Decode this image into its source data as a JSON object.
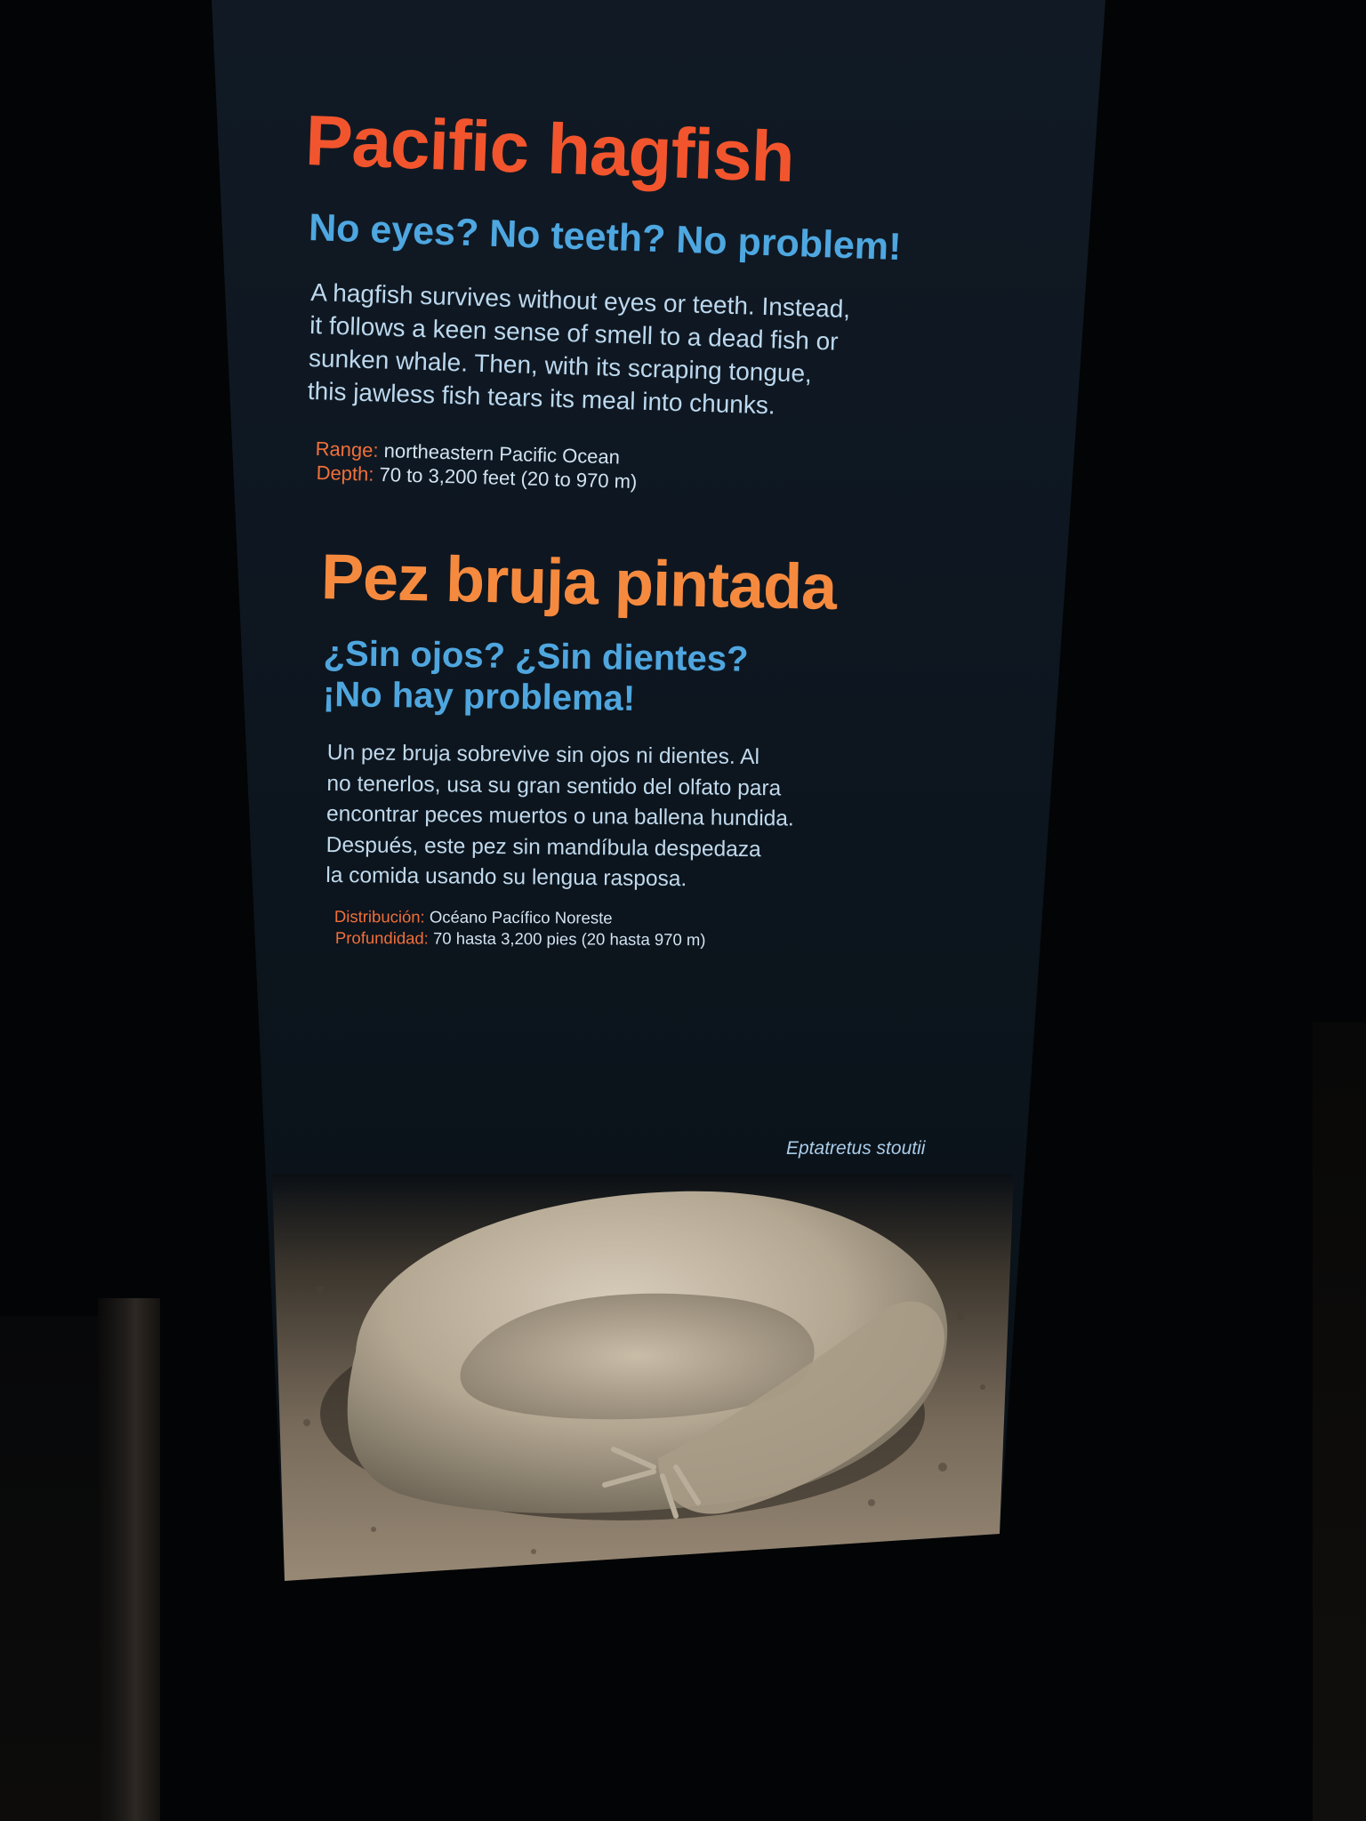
{
  "english": {
    "title": "Pacific hagfish",
    "subtitle": "No eyes? No teeth? No problem!",
    "body_lines": [
      "A hagfish survives without eyes or teeth. Instead,",
      "it follows a keen sense of smell to a dead fish or",
      "sunken whale. Then, with its scraping tongue,",
      "this jawless fish tears its meal into chunks."
    ],
    "range_label": "Range:",
    "range_value": "northeastern Pacific Ocean",
    "depth_label": "Depth:",
    "depth_value": "70 to 3,200 feet (20 to 970 m)"
  },
  "spanish": {
    "title": "Pez bruja pintada",
    "subtitle_lines": [
      "¿Sin ojos? ¿Sin dientes?",
      "¡No hay problema!"
    ],
    "body_lines": [
      "Un pez bruja sobrevive sin ojos ni dientes. Al",
      "no tenerlos, usa su gran sentido del olfato para",
      "encontrar peces muertos o una ballena hundida.",
      "Después, este pez sin mandíbula despedaza",
      "la comida usando su lengua rasposa."
    ],
    "distribution_label": "Distribución:",
    "distribution_value": "Océano Pacífico Noreste",
    "depth_label": "Profundidad:",
    "depth_value": "70 hasta 3,200 pies (20 hasta 970 m)"
  },
  "scientific_name": "Eptatretus stoutii",
  "colors": {
    "english_title": "#f2552d",
    "spanish_title": "#f58a3f",
    "subtitle": "#4ea7e0",
    "body": "#bcd8ee",
    "panel": "#0e1721"
  }
}
